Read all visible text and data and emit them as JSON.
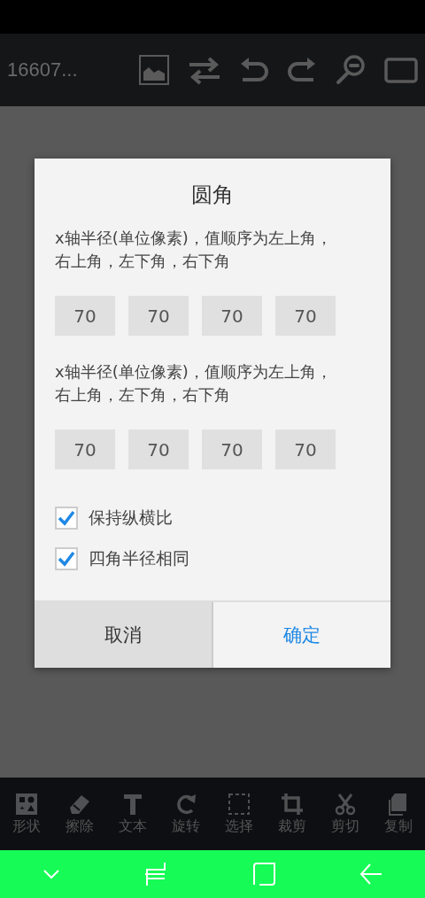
{
  "toolbar": {
    "title": "16607...",
    "icons": [
      {
        "kind": "image"
      },
      {
        "kind": "swap"
      },
      {
        "kind": "undo"
      },
      {
        "kind": "redo"
      },
      {
        "kind": "zoom-out"
      },
      {
        "kind": "frame"
      }
    ]
  },
  "dialog": {
    "title": "圆角",
    "groups": [
      {
        "description": "x轴半径(单位像素)，值顺序为左上角，右上角，左下角，右下角",
        "values": [
          "70",
          "70",
          "70",
          "70"
        ]
      },
      {
        "description": "x轴半径(单位像素)，值顺序为左上角，右上角，左下角，右下角",
        "values": [
          "70",
          "70",
          "70",
          "70"
        ]
      }
    ],
    "options": [
      {
        "label": "保持纵横比",
        "checked": true
      },
      {
        "label": "四角半径相同",
        "checked": true
      }
    ],
    "buttons": [
      {
        "label": "取消",
        "kind": "cancel"
      },
      {
        "label": "确定",
        "kind": "confirm"
      }
    ]
  },
  "tools": [
    {
      "label": "形状",
      "kind": "shapes"
    },
    {
      "label": "擦除",
      "kind": "eraser"
    },
    {
      "label": "文本",
      "kind": "text"
    },
    {
      "label": "旋转",
      "kind": "rotate"
    },
    {
      "label": "选择",
      "kind": "select"
    },
    {
      "label": "裁剪",
      "kind": "crop"
    },
    {
      "label": "剪切",
      "kind": "scissors"
    },
    {
      "label": "复制",
      "kind": "copy"
    }
  ]
}
